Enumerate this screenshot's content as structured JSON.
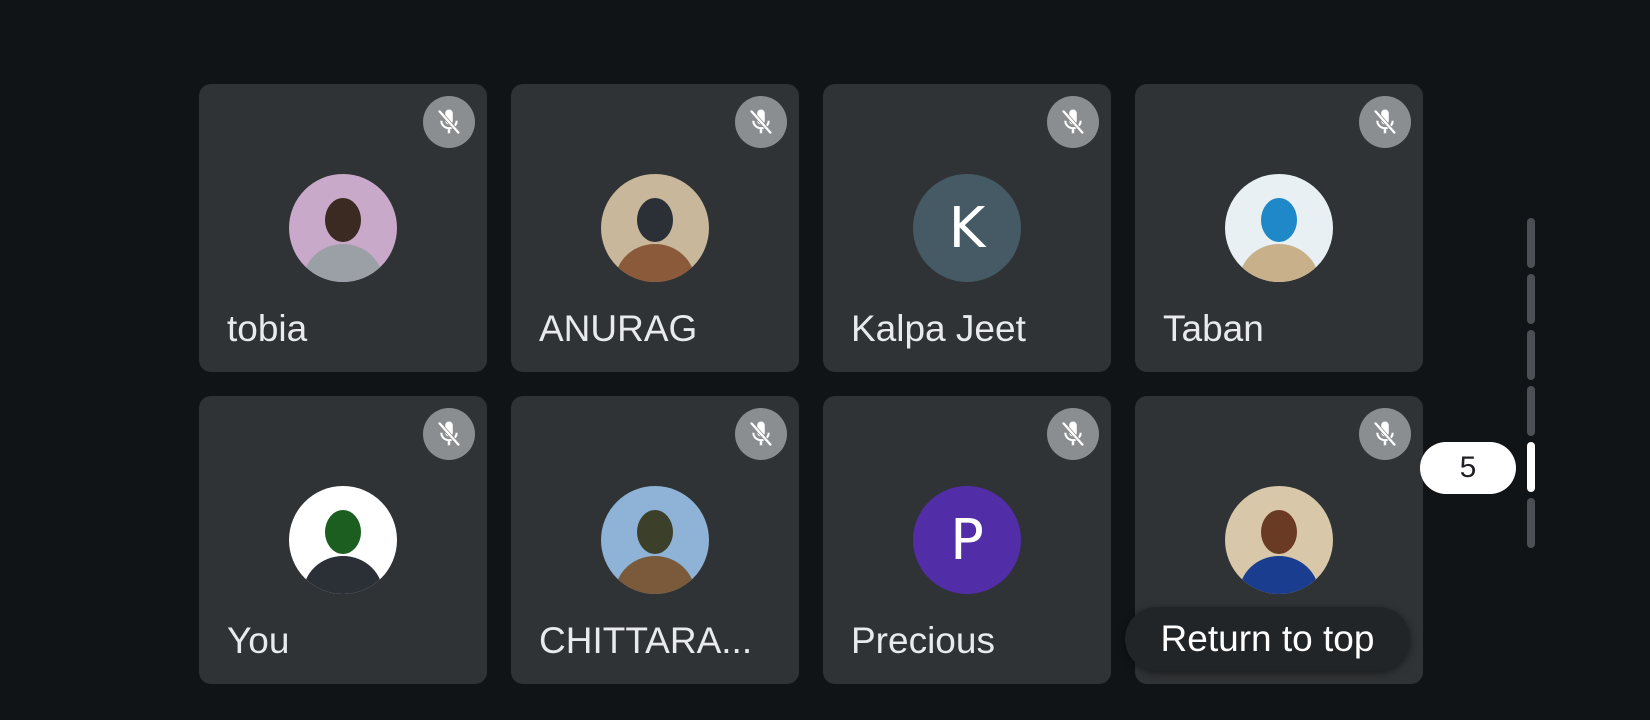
{
  "participants": [
    {
      "name": "tobia",
      "avatar_type": "photo",
      "photo_colors": [
        "#c9a9c9",
        "#3a2a22",
        "#9aa0a6"
      ],
      "muted": true
    },
    {
      "name": "ANURAG",
      "avatar_type": "photo",
      "photo_colors": [
        "#c9b79c",
        "#2b2f36",
        "#8a5a3a"
      ],
      "muted": true
    },
    {
      "name": "Kalpa Jeet",
      "avatar_type": "initial",
      "initial": "K",
      "color": "#455a64",
      "muted": true
    },
    {
      "name": "Taban",
      "avatar_type": "photo",
      "photo_colors": [
        "#e8f0f4",
        "#1e88c8",
        "#c8b08a"
      ],
      "muted": true
    },
    {
      "name": "You",
      "avatar_type": "photo",
      "photo_colors": [
        "#ffffff",
        "#1b5e20",
        "#2b2f36"
      ],
      "muted": true
    },
    {
      "name": "CHITTARA...",
      "avatar_type": "photo",
      "photo_colors": [
        "#8fb3d6",
        "#3c3f2a",
        "#7a5a3a"
      ],
      "muted": true
    },
    {
      "name": "Precious",
      "avatar_type": "initial",
      "initial": "P",
      "color": "#512da8",
      "muted": true
    },
    {
      "name": "",
      "avatar_type": "photo",
      "photo_colors": [
        "#d8c7a8",
        "#6b3a25",
        "#1a3d8f"
      ],
      "muted": true
    }
  ],
  "mute_icon": "mic-off-icon",
  "toast": {
    "label": "Return to top"
  },
  "pagination": {
    "current_page": "5",
    "total_segments": 6,
    "active_index": 4
  }
}
